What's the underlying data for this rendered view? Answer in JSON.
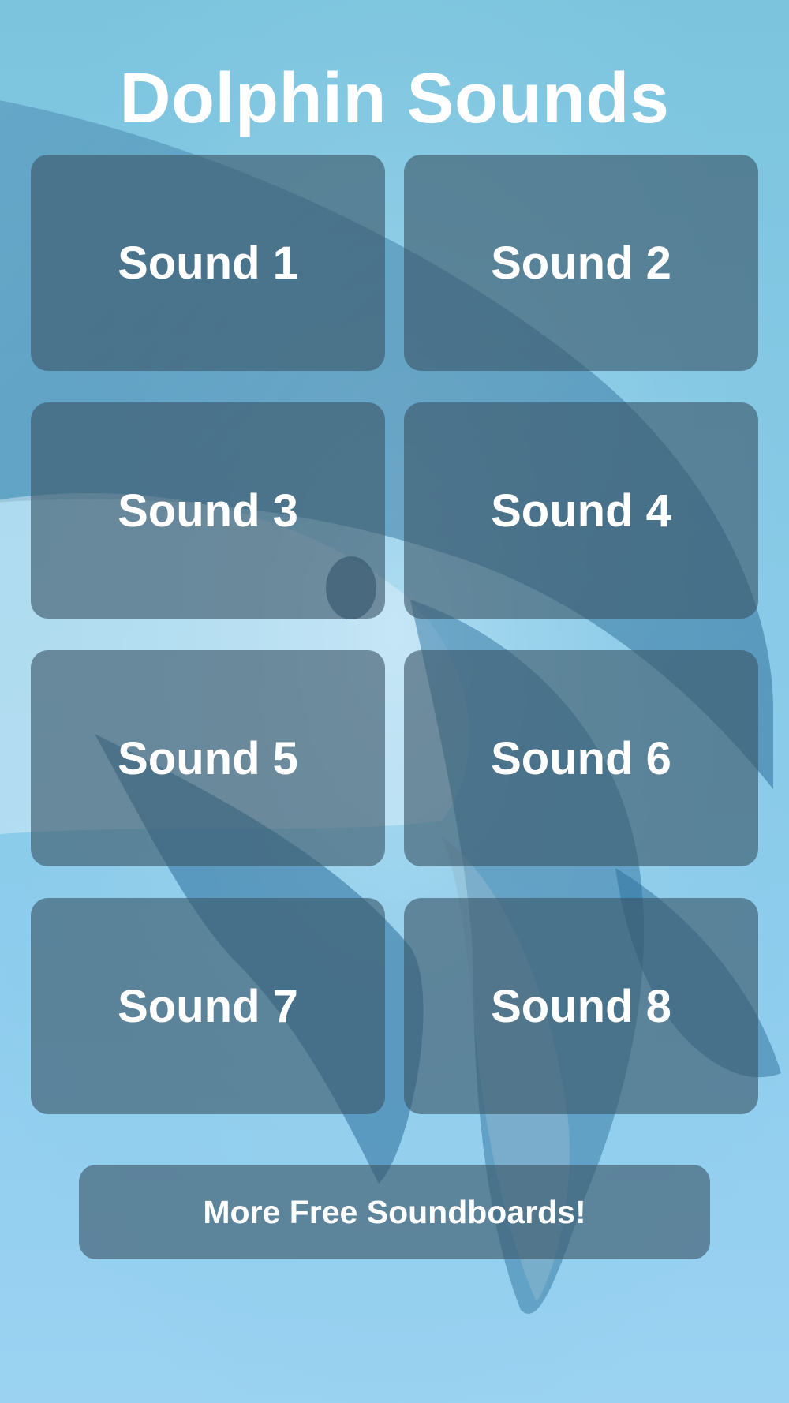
{
  "app": {
    "title": "Dolphin Sounds"
  },
  "sounds": [
    {
      "label": "Sound 1"
    },
    {
      "label": "Sound 2"
    },
    {
      "label": "Sound 3"
    },
    {
      "label": "Sound 4"
    },
    {
      "label": "Sound 5"
    },
    {
      "label": "Sound 6"
    },
    {
      "label": "Sound 7"
    },
    {
      "label": "Sound 8"
    }
  ],
  "footer": {
    "more_label": "More Free Soundboards!"
  },
  "colors": {
    "background_top": "#7cc4de",
    "background_bottom": "#9bd2f2",
    "button_fill": "#3a5668",
    "text": "#ffffff"
  }
}
